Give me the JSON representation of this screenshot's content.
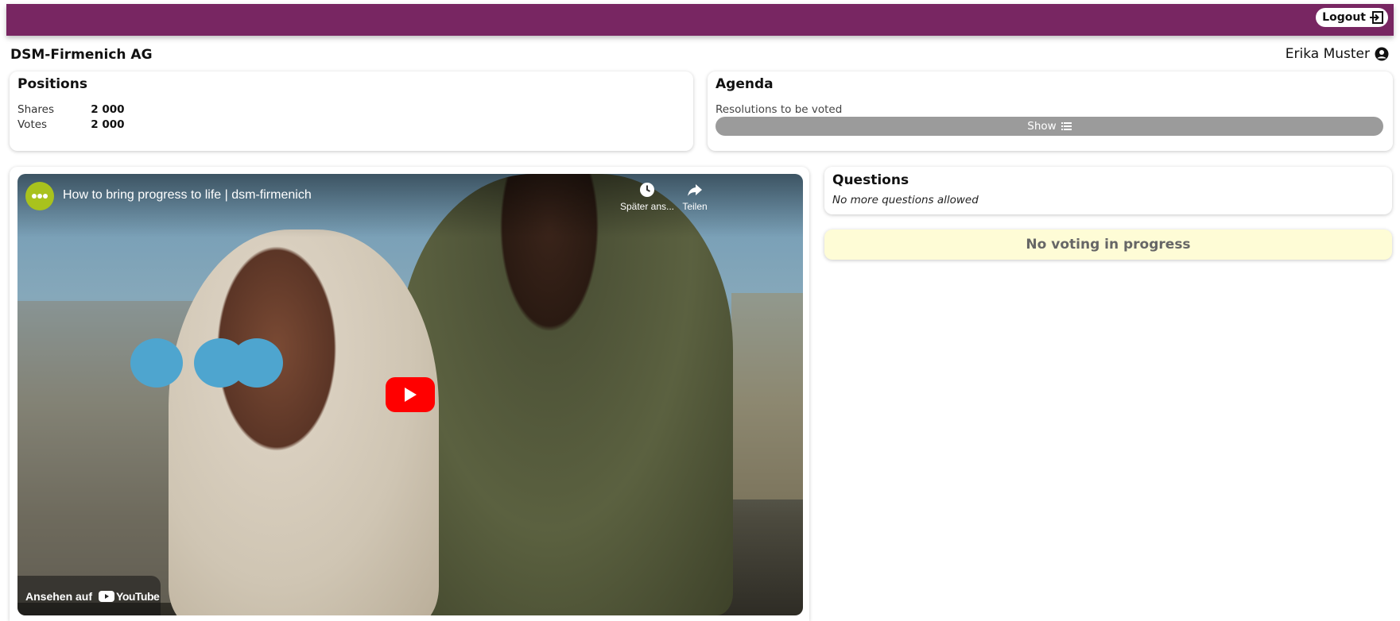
{
  "header": {
    "logout_label": "Logout",
    "brand_color": "#782662"
  },
  "company_name": "DSM-Firmenich AG",
  "user": {
    "name": "Erika Muster"
  },
  "positions": {
    "title": "Positions",
    "rows": [
      {
        "label": "Shares",
        "value": "2 000"
      },
      {
        "label": "Votes",
        "value": "2 000"
      }
    ]
  },
  "agenda": {
    "title": "Agenda",
    "subtitle": "Resolutions to be voted",
    "show_label": "Show"
  },
  "video": {
    "title": "How to bring progress to life | dsm-firmenich",
    "watch_later_label": "Später ans...",
    "share_label": "Teilen",
    "watch_on_label": "Ansehen auf",
    "youtube_label": "YouTube"
  },
  "questions": {
    "title": "Questions",
    "status": "No more questions allowed"
  },
  "voting": {
    "status": "No voting in progress"
  }
}
